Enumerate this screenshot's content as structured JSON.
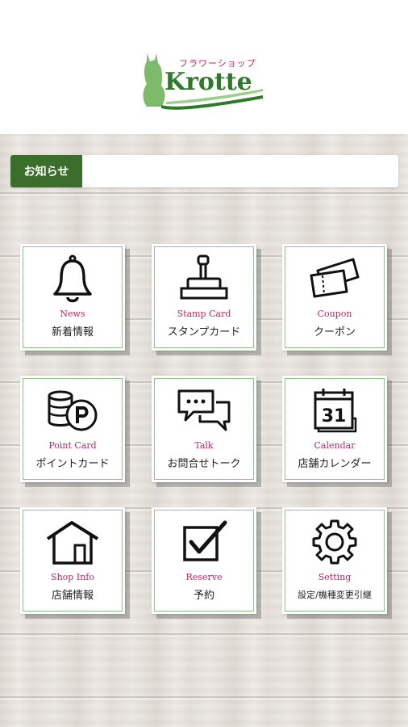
{
  "header": {
    "logo": {
      "subtitle": "フラワーショップ",
      "name": "Krotte"
    }
  },
  "news": {
    "label": "お知らせ",
    "content": ""
  },
  "menu": [
    {
      "en": "News",
      "jp": "新着情報",
      "icon": "bell-icon"
    },
    {
      "en": "Stamp Card",
      "jp": "スタンプカード",
      "icon": "stamp-icon"
    },
    {
      "en": "Coupon",
      "jp": "クーポン",
      "icon": "coupon-icon"
    },
    {
      "en": "Point Card",
      "jp": "ポイントカード",
      "icon": "coins-icon"
    },
    {
      "en": "Talk",
      "jp": "お問合せトーク",
      "icon": "chat-bubbles-icon"
    },
    {
      "en": "Calendar",
      "jp": "店舗カレンダー",
      "icon": "calendar-icon",
      "icon_text": "31"
    },
    {
      "en": "Shop Info",
      "jp": "店舗情報",
      "icon": "house-icon"
    },
    {
      "en": "Reserve",
      "jp": "予約",
      "icon": "checkbox-icon"
    },
    {
      "en": "Setting",
      "jp": "設定/機種変更引継",
      "icon": "gear-icon"
    }
  ],
  "colors": {
    "accent_green": "#3a6e2a",
    "label_pink": "#c8245a",
    "tile_border": "#8fc489"
  }
}
